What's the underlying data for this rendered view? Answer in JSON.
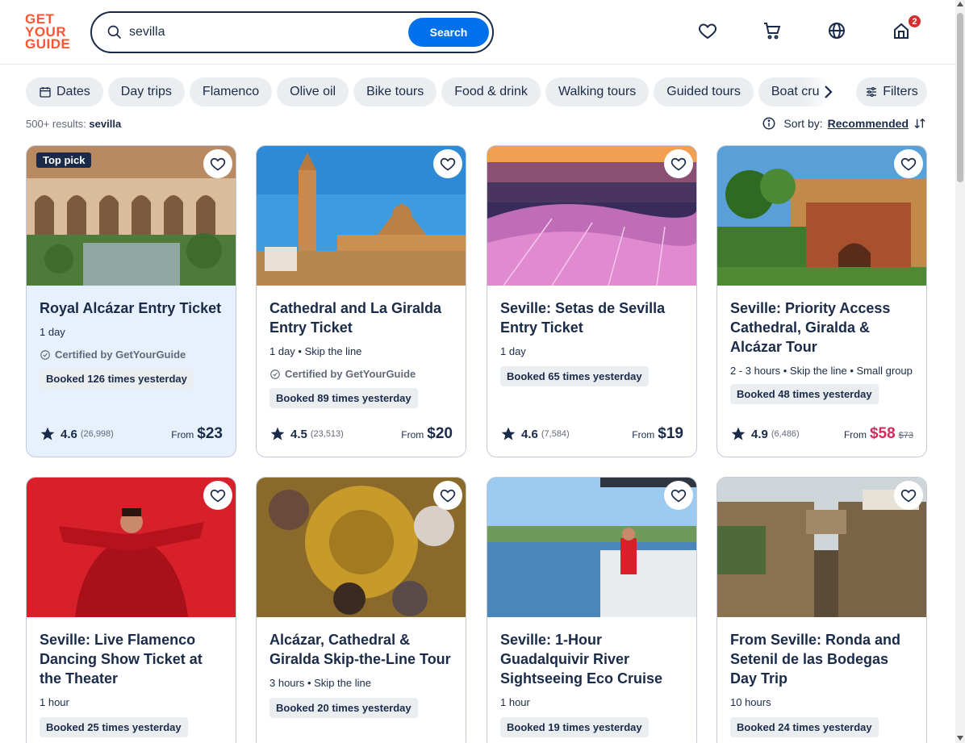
{
  "logo": {
    "line1": "GET",
    "line2": "YOUR",
    "line3": "GUIDE"
  },
  "search": {
    "value": "sevilla",
    "button_label": "Search"
  },
  "header": {
    "cart_count": "2"
  },
  "chips": [
    "Dates",
    "Day trips",
    "Flamenco",
    "Olive oil",
    "Bike tours",
    "Food & drink",
    "Walking tours",
    "Guided tours",
    "Boat cru"
  ],
  "filters_label": "Filters",
  "results": {
    "count": "500+ results:",
    "query": "sevilla"
  },
  "sort": {
    "label": "Sort by:",
    "value": "Recommended"
  },
  "cards": [
    {
      "badge": "Top pick",
      "title": "Royal Alcázar Entry Ticket",
      "meta": "1 day",
      "certified": "Certified by GetYourGuide",
      "booked": "Booked 126 times yesterday",
      "rating": "4.6",
      "reviews": "(26,998)",
      "from": "From",
      "price": "$23",
      "old_price": ""
    },
    {
      "badge": "",
      "title": "Cathedral and La Giralda Entry Ticket",
      "meta": "1 day • Skip the line",
      "certified": "Certified by GetYourGuide",
      "booked": "Booked 89 times yesterday",
      "rating": "4.5",
      "reviews": "(23,513)",
      "from": "From",
      "price": "$20",
      "old_price": ""
    },
    {
      "badge": "",
      "title": "Seville: Setas de Sevilla Entry Ticket",
      "meta": "1 day",
      "certified": "",
      "booked": "Booked 65 times yesterday",
      "rating": "4.6",
      "reviews": "(7,584)",
      "from": "From",
      "price": "$19",
      "old_price": ""
    },
    {
      "badge": "",
      "title": "Seville: Priority Access Cathedral, Giralda & Alcázar Tour",
      "meta": "2 - 3 hours • Skip the line • Small group",
      "certified": "",
      "booked": "Booked 48 times yesterday",
      "rating": "4.9",
      "reviews": "(6,486)",
      "from": "From",
      "price": "$58",
      "old_price": "$73"
    },
    {
      "badge": "",
      "title": "Seville: Live Flamenco Dancing Show Ticket at the Theater",
      "meta": "1 hour",
      "certified": "",
      "booked": "Booked 25 times yesterday"
    },
    {
      "badge": "",
      "title": "Alcázar, Cathedral & Giralda Skip-the-Line Tour",
      "meta": "3 hours • Skip the line",
      "certified": "",
      "booked": "Booked 20 times yesterday"
    },
    {
      "badge": "",
      "title": "Seville: 1-Hour Guadalquivir River Sightseeing Eco Cruise",
      "meta": "1 hour",
      "certified": "",
      "booked": "Booked 19 times yesterday"
    },
    {
      "badge": "",
      "title": "From Seville: Ronda and Setenil de las Bodegas Day Trip",
      "meta": "10 hours",
      "certified": "",
      "booked": "Booked 24 times yesterday"
    }
  ],
  "colors": {
    "brand": "#ff5533",
    "accent": "#0071eb",
    "text": "#1a2b49",
    "sale": "#d42a5b",
    "highlight": "#e6f1fd"
  }
}
